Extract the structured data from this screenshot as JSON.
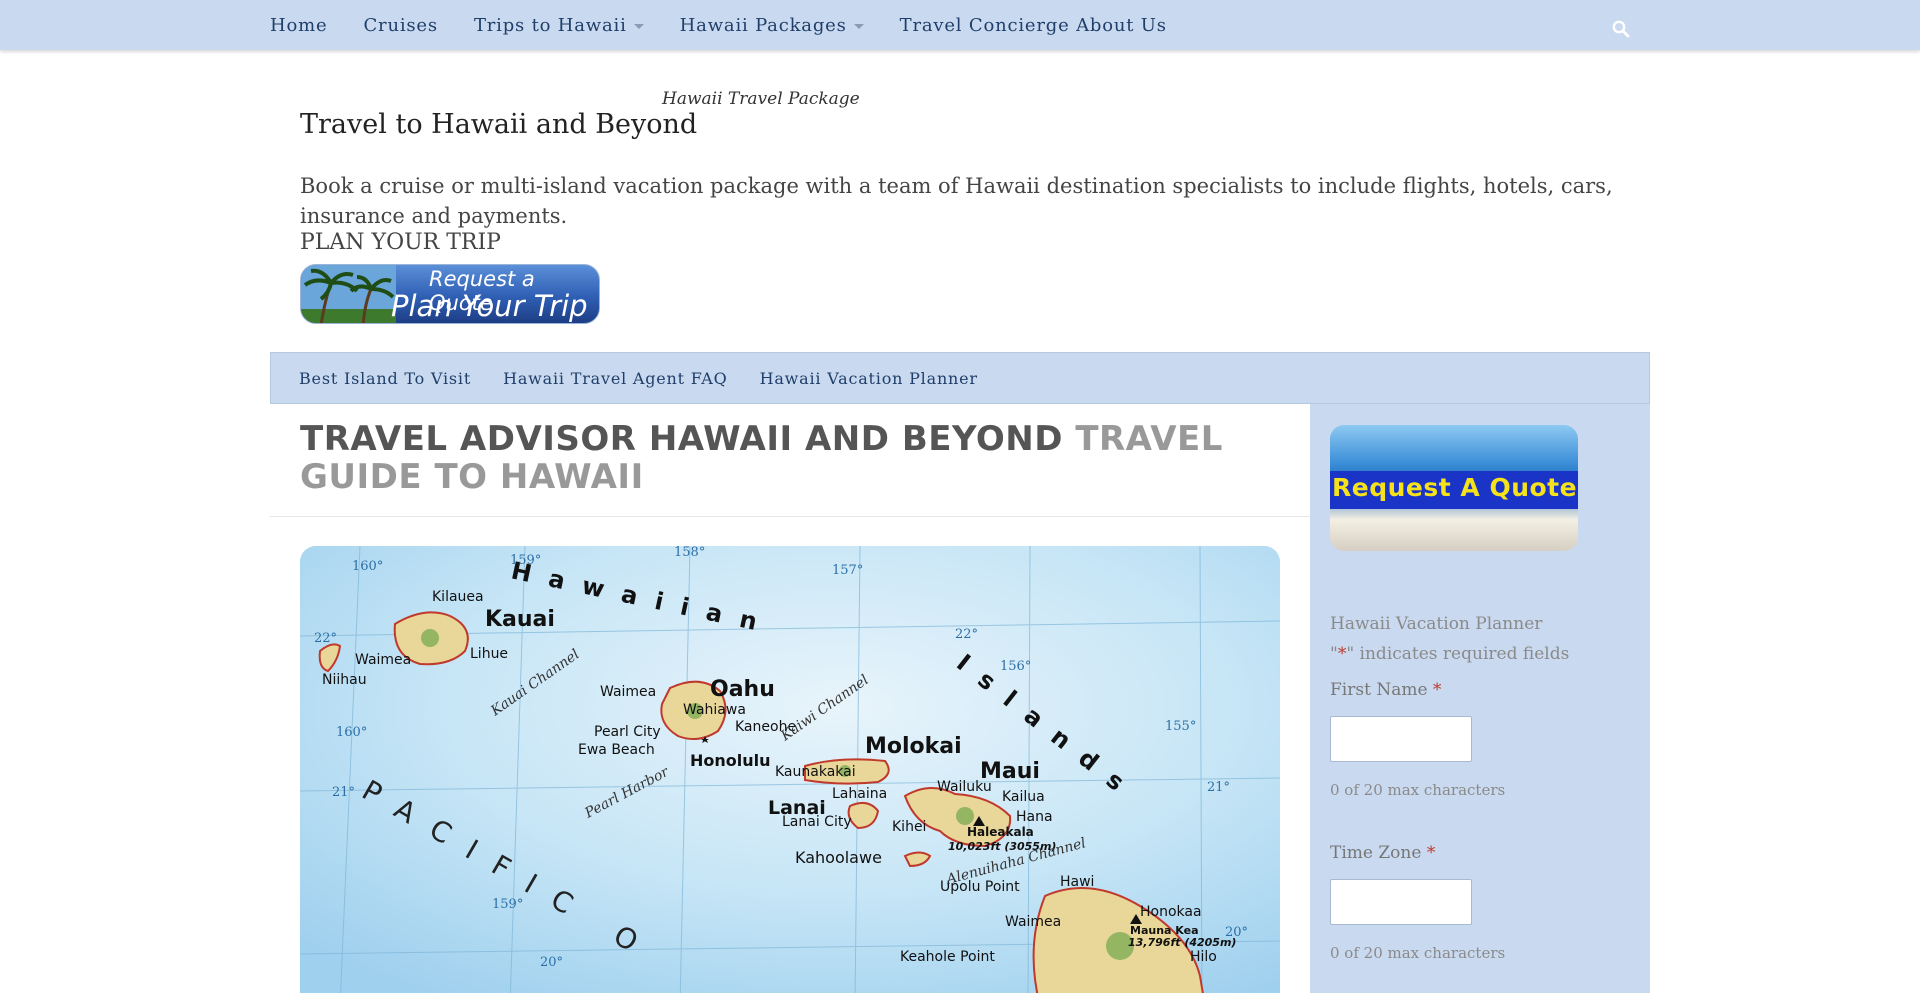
{
  "topnav": {
    "items": [
      {
        "label": "Home"
      },
      {
        "label": "Cruises"
      },
      {
        "label": "Trips to Hawaii"
      },
      {
        "label": "Hawaii Packages"
      },
      {
        "label": "Travel Concierge About Us"
      }
    ]
  },
  "header": {
    "tagline": "Hawaii Travel Package",
    "title": "Travel to Hawaii and Beyond",
    "description": "Book a cruise or multi-island vacation package with a team of Hawaii destination specialists to include flights, hotels, cars, insurance and payments.",
    "plan_label": "PLAN YOUR TRIP",
    "banner_line1": "Request a Quote",
    "banner_line2": "Plan Your Trip"
  },
  "subnav": {
    "items": [
      {
        "label": "Best Island To Visit"
      },
      {
        "label": "Hawaii Travel Agent FAQ"
      },
      {
        "label": "Hawaii Vacation Planner"
      }
    ]
  },
  "main": {
    "heading_dark": "TRAVEL ADVISOR HAWAII AND BEYOND",
    "heading_light": "TRAVEL GUIDE TO HAWAII"
  },
  "map": {
    "title_word1": "Hawaiian",
    "title_word2": "Islands",
    "ocean": "PACIFIC O",
    "islands": {
      "kauai": "Kauai",
      "oahu": "Oahu",
      "molokai": "Molokai",
      "maui": "Maui",
      "lanai": "Lanai",
      "kahoolawe": "Kahoolawe",
      "niihau": "Niihau"
    },
    "places": {
      "kilauea": "Kilauea",
      "lihue": "Lihue",
      "waimea_k": "Waimea",
      "waimea_o": "Waimea",
      "wahiawa": "Wahiawa",
      "pearl_city": "Pearl City",
      "ewa_beach": "Ewa Beach",
      "kaneohe": "Kaneohe",
      "honolulu": "Honolulu",
      "kaunakakai": "Kaunakakai",
      "lahaina": "Lahaina",
      "wailuku": "Wailuku",
      "kailua": "Kailua",
      "hana": "Hana",
      "kihei": "Kihei",
      "lanai_city": "Lanai City",
      "haleakala": "Haleakala",
      "haleakala_elev": "10,023ft (3055m)",
      "upolu": "Upolu Point",
      "hawi": "Hawi",
      "waimea_h": "Waimea",
      "honokaa": "Honokaa",
      "mauna_kea": "Mauna Kea",
      "mauna_kea_elev": "13,796ft (4205m)",
      "keahole": "Keahole Point",
      "hilo": "Hilo"
    },
    "channels": {
      "kauai_channel": "Kauai Channel",
      "kaiwi_channel": "Kaiwi Channel",
      "pearl_harbor": "Pearl Harbor",
      "alenuihaha": "Alenuihaha Channel"
    },
    "grid": {
      "lon160": "160°",
      "lon159": "159°",
      "lon158": "158°",
      "lon157": "157°",
      "lon156": "156°",
      "lon155": "155°",
      "lat22a": "22°",
      "lat22b": "22°",
      "lat21a": "21°",
      "lat21b": "21°",
      "lat20a": "20°",
      "lat20b": "20°",
      "lon160b": "160°",
      "lon159b": "159°"
    }
  },
  "sidebar": {
    "banner_text": "Request A Quote",
    "form_title": "Hawaii Vacation Planner",
    "req_prefix": "\"",
    "req_star": "*",
    "req_suffix": "\" indicates required fields",
    "fields": [
      {
        "label": "First Name",
        "required": "*",
        "counter": "0 of 20 max characters"
      },
      {
        "label": "Time Zone",
        "required": "*",
        "counter": "0 of 20 max characters"
      }
    ]
  },
  "colors": {
    "nav_bg": "#c9d9ef",
    "nav_text": "#1f3f6a",
    "required": "#c0392b"
  }
}
